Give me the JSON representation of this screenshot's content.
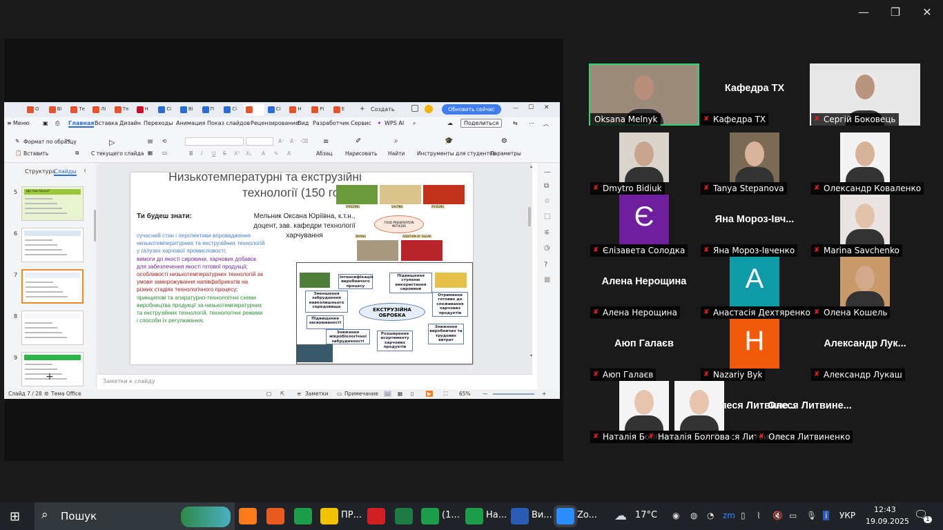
{
  "zoom": {
    "window_controls": {
      "minimize": "—",
      "restore": "❐",
      "close": "✕"
    }
  },
  "wps": {
    "tabs": [
      {
        "label": "О",
        "color": "#e5532d"
      },
      {
        "label": "Ві",
        "color": "#e5532d"
      },
      {
        "label": "Те",
        "color": "#e5532d"
      },
      {
        "label": "Лі",
        "color": "#e5532d"
      },
      {
        "label": "Те",
        "color": "#e5532d"
      },
      {
        "label": "Н",
        "color": "#c8102e"
      },
      {
        "label": "Сі",
        "color": "#2b6cd6"
      },
      {
        "label": "Ві",
        "color": "#2b6cd6"
      },
      {
        "label": "П",
        "color": "#2b6cd6"
      },
      {
        "label": "Сі",
        "color": "#2b6cd6"
      },
      {
        "label": "",
        "color": "#e5532d"
      },
      {
        "label": "Сі",
        "color": "#2b6cd6"
      },
      {
        "label": "Н",
        "color": "#e5532d"
      },
      {
        "label": "Рі",
        "color": "#e5532d"
      },
      {
        "label": "Е",
        "color": "#e5532d"
      }
    ],
    "create_label": "Создать",
    "update_button": "Обновить сейчас",
    "menu": [
      "Меню",
      "Главная",
      "Вставка",
      "Дизайн",
      "Переходы",
      "Анимация",
      "Показ слайдов",
      "Рецензирование",
      "Вид",
      "Разработчик",
      "Сервис",
      "WPS AI"
    ],
    "share_button": "Поделиться",
    "ribbon": {
      "format_painter": "Формат по образцу",
      "paste": "Вставить",
      "from_current": "С текущего слайда",
      "paragraph": "Абзац",
      "draw": "Нарисовать",
      "find": "Найти",
      "student_tools": "Инструменты для студентов",
      "params": "Параметры",
      "format_labels": [
        "B",
        "I",
        "U",
        "S",
        "X²",
        "X₂"
      ]
    },
    "panel_tabs": {
      "structure": "Структура",
      "slides": "Слайды"
    },
    "thumbs": [
      {
        "num": "5",
        "title": "Що таке Ценоз?"
      },
      {
        "num": "6",
        "title": ""
      },
      {
        "num": "7",
        "title": ""
      },
      {
        "num": "8",
        "title": ""
      },
      {
        "num": "9",
        "title": ""
      }
    ],
    "add_slide": "+",
    "notes_placeholder": "Заметки к слайду",
    "status": {
      "slide_count": "Слайд 7 / 28",
      "theme": "Тема Office",
      "notes": "Заметки",
      "comment": "Примечание",
      "zoom": "65%"
    }
  },
  "slide": {
    "title_line1": "Низькотемпературні та екструзійні",
    "title_line2": "технології (150 год)",
    "you_will_know": "Ти будеш знати:",
    "author_line1": "Мельник Оксана Юріївна, к.т.н.,",
    "author_line2": "доцент, зав. кафедри технології",
    "author_line3": "харчування",
    "bullets": [
      {
        "text": "сучасний стан і перспективи впровадження низькотемпературних та екструзійних технологій у галузях харчової промисловості;",
        "color": "#4b7fc0"
      },
      {
        "text": "вимоги до якості сировини, харчових добавок для забезпечення якості готової продукції;",
        "color": "#6a2a8c"
      },
      {
        "text": "особливості низькотемпературних технологій за умови заморожування напівфабрикатів на різних стадіях технологічного процесу;",
        "color": "#a02020"
      },
      {
        "text": "принципові та апаратурно-технологічні схеми виробництва продукції за низькотемпературних та екструзійних технологій, технологічні режими і способи їх регулювання.",
        "color": "#2e8b3a"
      }
    ],
    "food_labels": [
      "FREEZING",
      "SALTING",
      "PICKLING",
      "FOOD PRESERVATION METHODS",
      "DRYING",
      "ADDITION OF SUGAR"
    ],
    "extrusion": {
      "center": "ЕКСТРУЗІЙНА ОБРОБКА",
      "nodes": [
        "Інтенсифікація виробничого процесу",
        "Підвищення ступеню використання сировини",
        "Зменшення забруднення навколишнього середовища",
        "Отримання готових до споживання харчових продуктів",
        "Підвищення засвоюваності",
        "Зниження мікробіологічної забрудненості",
        "Розширення асортименту харчових продуктів",
        "Зниження виробничих та трудових витрат"
      ]
    }
  },
  "participants": [
    {
      "name": "Oksana Melnyk",
      "type": "video",
      "muted": false,
      "active": true,
      "skin": "#b98f7c",
      "bg": "#9c8b7a"
    },
    {
      "name": "Кафедра ТХ",
      "type": "text",
      "muted": true,
      "big": "Кафедра ТХ"
    },
    {
      "name": "Сергій Боковець",
      "type": "video",
      "muted": true,
      "skin": "#b9957f",
      "bg": "#e8e8e8"
    },
    {
      "name": "Dmytro Bidiuk",
      "type": "video",
      "muted": true,
      "skin": "#c9a58d",
      "bg": "#d9d4cc"
    },
    {
      "name": "Tanya Stepanova",
      "type": "video",
      "muted": true,
      "skin": "#d8b49c",
      "bg": "#7b6a55"
    },
    {
      "name": "Олександр Коваленко",
      "type": "video",
      "muted": true,
      "skin": "#d7b39a",
      "bg": "#f3f3f3"
    },
    {
      "name": "Єлізавета Солодка",
      "type": "letter",
      "muted": true,
      "letter": "Є",
      "color": "#6d1f9e"
    },
    {
      "name": "Яна Мороз-Івченко",
      "type": "text",
      "muted": true,
      "big": "Яна  Мороз-Івч..."
    },
    {
      "name": "Marina Savchenko",
      "type": "video",
      "muted": true,
      "skin": "#e3c2ab",
      "bg": "#e9e4e2"
    },
    {
      "name": "Алена Нерощина",
      "type": "text",
      "muted": true,
      "big": "Алена Нерощина"
    },
    {
      "name": "Анастасія Дехтяренко",
      "type": "letter",
      "muted": true,
      "letter": "А",
      "color": "#0e9aa7"
    },
    {
      "name": "Олена Кошель",
      "type": "video",
      "muted": true,
      "skin": "#d4a88a",
      "bg": "#c89a6a"
    },
    {
      "name": "Аюп Галаєв",
      "type": "text",
      "muted": true,
      "big": "Аюп Галаєв"
    },
    {
      "name": "Nazariy Byk",
      "type": "letter",
      "muted": true,
      "letter": "H",
      "color": "#f05a0a"
    },
    {
      "name": "Александр Лукаш",
      "type": "text",
      "muted": true,
      "big": "Александр  Лук..."
    },
    {
      "name": "Наталія Болгова",
      "type": "video",
      "muted": true,
      "skin": "#e6c4ad",
      "bg": "#f4f4f4"
    },
    {
      "name": "Олеся Литвиненко",
      "type": "text",
      "muted": true,
      "big": "Олеся  Литвине..."
    }
  ],
  "taskbar": {
    "search": "Пошук",
    "apps": [
      {
        "label": "",
        "color": "#ff7a1a"
      },
      {
        "label": "",
        "color": "#e85a1f"
      },
      {
        "label": "",
        "color": "#1e9e4a"
      },
      {
        "label": "ПР...",
        "color": "#f2c300"
      },
      {
        "label": "",
        "color": "#d11f26"
      },
      {
        "label": "",
        "color": "#1d7a44"
      },
      {
        "label": "(1...",
        "color": "#1e9e4a"
      },
      {
        "label": "На...",
        "color": "#1e9e4a"
      },
      {
        "label": "Ви...",
        "color": "#2b5bb5"
      },
      {
        "label": "Zo...",
        "color": "#2d8cff"
      }
    ],
    "weather": "17°C",
    "lang": "УКР",
    "time": "12:43",
    "date": "19.09.2025",
    "notif": "1"
  }
}
